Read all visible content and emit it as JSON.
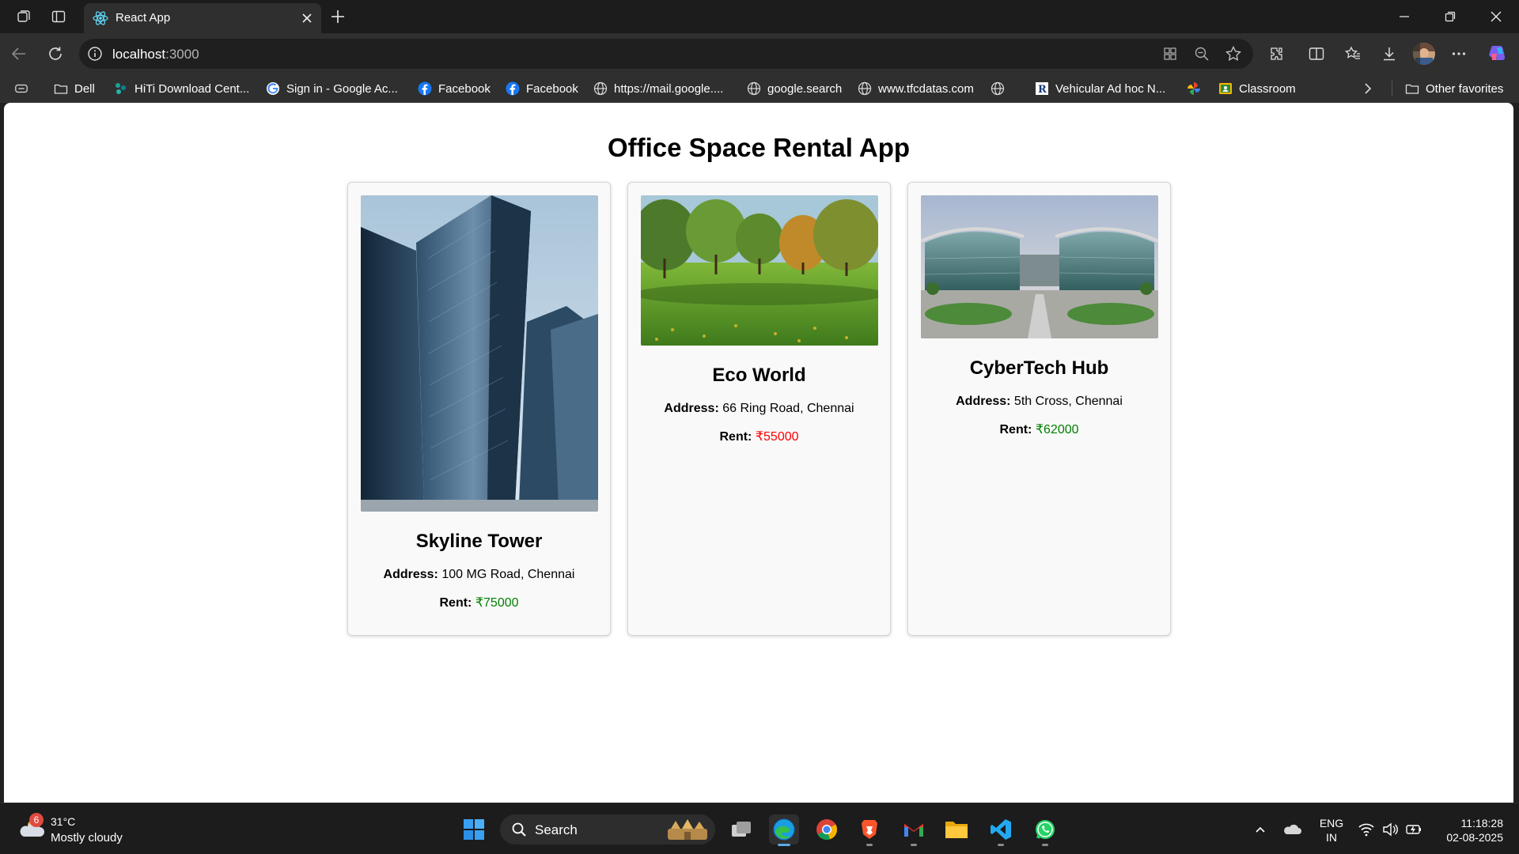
{
  "browser": {
    "tab_title": "React App",
    "url_host": "localhost",
    "url_port": ":3000",
    "bookmarks": [
      {
        "label": "Dell",
        "icon": "folder-icon"
      },
      {
        "label": "HiTi Download Cent...",
        "icon": "hiti-icon"
      },
      {
        "label": "Sign in - Google Ac...",
        "icon": "google-icon"
      },
      {
        "label": "Facebook",
        "icon": "facebook-icon"
      },
      {
        "label": "Facebook",
        "icon": "facebook-icon"
      },
      {
        "label": "https://mail.google....",
        "icon": "globe-icon"
      },
      {
        "label": "google.search",
        "icon": "globe-icon"
      },
      {
        "label": "www.tfcdatas.com",
        "icon": "globe-icon"
      },
      {
        "label": "",
        "icon": "globe-icon"
      },
      {
        "label": "Vehicular Ad hoc N...",
        "icon": "r-icon"
      },
      {
        "label": "",
        "icon": "pinwheel-icon"
      },
      {
        "label": "Classroom",
        "icon": "classroom-icon"
      }
    ],
    "other_favorites": "Other favorites"
  },
  "page": {
    "title": "Office Space Rental App",
    "address_label": "Address:",
    "rent_label": "Rent:",
    "currency": "₹",
    "offices": [
      {
        "name": "Skyline Tower",
        "address": "100 MG Road, Chennai",
        "rent": "75000",
        "rent_color": "#008000",
        "image": "skyscraper-photo"
      },
      {
        "name": "Eco World",
        "address": "66 Ring Road, Chennai",
        "rent": "55000",
        "rent_color": "#ff0000",
        "image": "park-photo"
      },
      {
        "name": "CyberTech Hub",
        "address": "5th Cross, Chennai",
        "rent": "62000",
        "rent_color": "#008000",
        "image": "campus-photo"
      }
    ]
  },
  "taskbar": {
    "weather_badge": "6",
    "temperature": "31°C",
    "condition": "Mostly cloudy",
    "search_label": "Search",
    "lang_line1": "ENG",
    "lang_line2": "IN",
    "time": "11:18:28",
    "date": "02-08-2025"
  }
}
